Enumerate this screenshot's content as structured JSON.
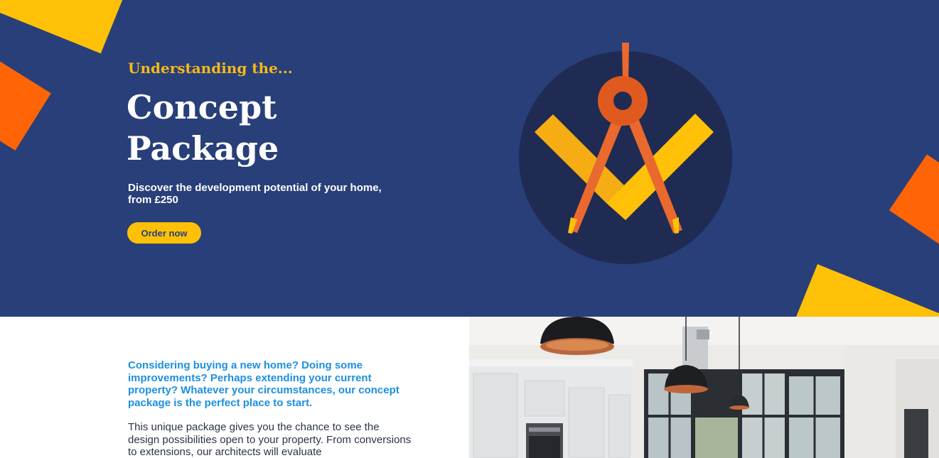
{
  "hero": {
    "kicker": "Understanding the...",
    "title": "Concept Package",
    "subtitle": "Discover the development potential of your home, from £250",
    "cta_label": "Order now",
    "illustration_icon": "compass-checkmark-icon",
    "colors": {
      "background": "#283f79",
      "accent_yellow": "#fec107",
      "accent_orange": "#ff6506",
      "kicker": "#f6b81a"
    }
  },
  "intro": {
    "lead": "Considering buying a new home? Doing some improvements? Perhaps extending your current property? Whatever your circumstances, our concept package is the perfect place to start.",
    "body": "This unique package gives you the chance to see the design possibilities open to your property. From conversions to extensions, our architects will evaluate",
    "lead_color": "#1d8fe0"
  },
  "photo": {
    "subject": "kitchen-interior-image"
  }
}
